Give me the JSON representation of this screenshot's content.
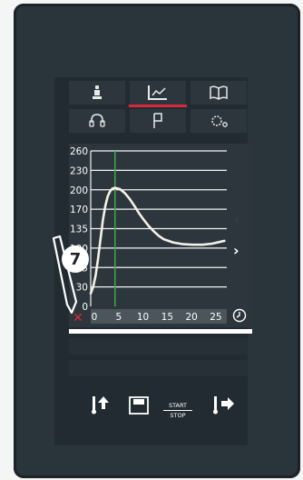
{
  "tabs": {
    "row1": [
      {
        "name": "operator",
        "icon": "chef-icon"
      },
      {
        "name": "graph",
        "icon": "graph-icon",
        "active": true
      },
      {
        "name": "book",
        "icon": "book-icon"
      }
    ],
    "row2": [
      {
        "name": "headset",
        "icon": "headset-icon"
      },
      {
        "name": "flag",
        "icon": "flag-icon"
      },
      {
        "name": "settings",
        "icon": "gear-icon"
      }
    ]
  },
  "badge": {
    "number": "7"
  },
  "bottom": {
    "start_label": "START",
    "stop_label": "STOP",
    "icons": [
      "probe-up-icon",
      "save-icon",
      "probe-right-icon"
    ]
  },
  "colors": {
    "accent_red": "#d8293a",
    "marker_green": "#3ea84a",
    "curve": "#f5f1e8"
  },
  "chart_data": {
    "type": "line",
    "x_ticks": [
      0,
      5,
      10,
      15,
      20,
      25
    ],
    "y_ticks": [
      0,
      30,
      65,
      100,
      135,
      170,
      200,
      230,
      260
    ],
    "xlim": [
      0,
      28
    ],
    "ylim": [
      0,
      260
    ],
    "marker_x": 5,
    "series": [
      {
        "x": [
          0,
          0.5,
          1,
          1.5,
          2,
          2.5,
          3,
          3.5,
          4,
          4.5,
          5,
          6,
          7,
          8,
          9,
          10,
          11,
          12,
          13,
          14,
          15,
          17,
          19,
          21,
          23,
          25,
          27.5
        ],
        "y": [
          20,
          30,
          50,
          80,
          115,
          150,
          175,
          190,
          198,
          202,
          203,
          201,
          195,
          186,
          175,
          162,
          150,
          139,
          130,
          122,
          116,
          110,
          107,
          106,
          106,
          108,
          113
        ]
      }
    ]
  }
}
